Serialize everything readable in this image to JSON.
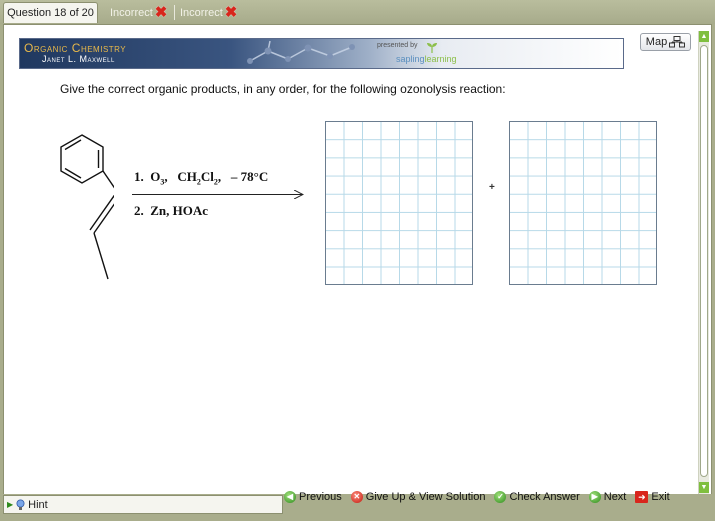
{
  "tabs": {
    "question": "Question 18 of 20",
    "attempt1": "Incorrect",
    "attempt2": "Incorrect"
  },
  "banner": {
    "title": "Organic Chemistry",
    "author": "Janet L. Maxwell",
    "presented_by": "presented by",
    "brand_a": "sapling",
    "brand_b": "learning"
  },
  "map": {
    "label": "Map"
  },
  "question": {
    "prompt": "Give the correct organic products, in any order, for the following ozonolysis reaction:",
    "step1_num": "1.",
    "step1_o": "O",
    "step1_o_sub": "3",
    "step1_sep1": ",",
    "step1_ch": "CH",
    "step1_ch_sub": "2",
    "step1_cl": "Cl",
    "step1_cl_sub": "2",
    "step1_sep2": ",",
    "step1_temp": "– 78°C",
    "step2_num": "2.",
    "step2_text": "Zn,  HOAc",
    "plus": "+"
  },
  "nav": {
    "hint": "Hint",
    "previous": "Previous",
    "give_up": "Give Up & View Solution",
    "check": "Check Answer",
    "next": "Next",
    "exit": "Exit"
  },
  "colors": {
    "accent_green": "#2e8a1c",
    "incorrect_red": "#d8261c",
    "banner_navy": "#20385f",
    "grid_line": "#b7d9e8"
  },
  "icons": [
    "cross-icon",
    "map-icon",
    "prev-arrow-icon",
    "give-up-icon",
    "check-icon",
    "next-arrow-icon",
    "exit-icon",
    "hint-bulb-icon"
  ]
}
